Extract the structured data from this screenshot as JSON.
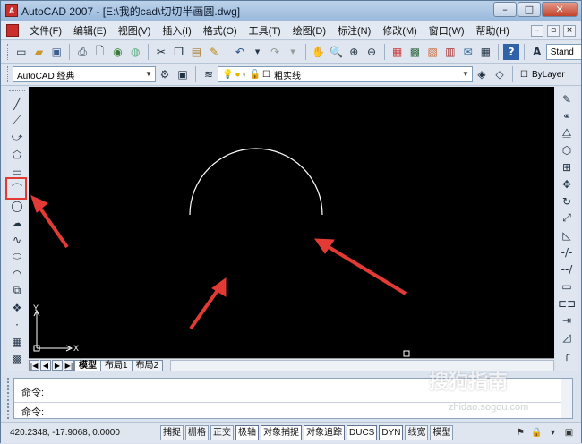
{
  "window": {
    "title": "AutoCAD 2007 - [E:\\我的cad\\切切半画圆.dwg]",
    "app_icon_text": "A"
  },
  "menus": [
    "文件(F)",
    "编辑(E)",
    "视图(V)",
    "插入(I)",
    "格式(O)",
    "工具(T)",
    "绘图(D)",
    "标注(N)",
    "修改(M)",
    "窗口(W)",
    "帮助(H)"
  ],
  "toolbar2": {
    "workspace": "AutoCAD 经典",
    "layer_name": "粗实线",
    "color": "ByLayer"
  },
  "toolbar1": {
    "style_text": "Stand"
  },
  "ucs": {
    "x_label": "X",
    "y_label": "Y"
  },
  "layout_tabs": [
    "模型",
    "布局1",
    "布局2"
  ],
  "command": {
    "line1": "命令:",
    "line2": "命令:"
  },
  "status": {
    "coords": "420.2348,  -17.9068, 0.0000",
    "buttons": [
      "捕捉",
      "栅格",
      "正交",
      "极轴",
      "对象捕捉",
      "对象追踪",
      "DUCS",
      "DYN",
      "线宽",
      "模型"
    ]
  },
  "watermark": {
    "site": "zhidao.sogou.com",
    "brand": "搜狗指南"
  },
  "colors": {
    "canvas": "#000000",
    "arrow": "#e23a35",
    "arc": "#ffffff"
  }
}
